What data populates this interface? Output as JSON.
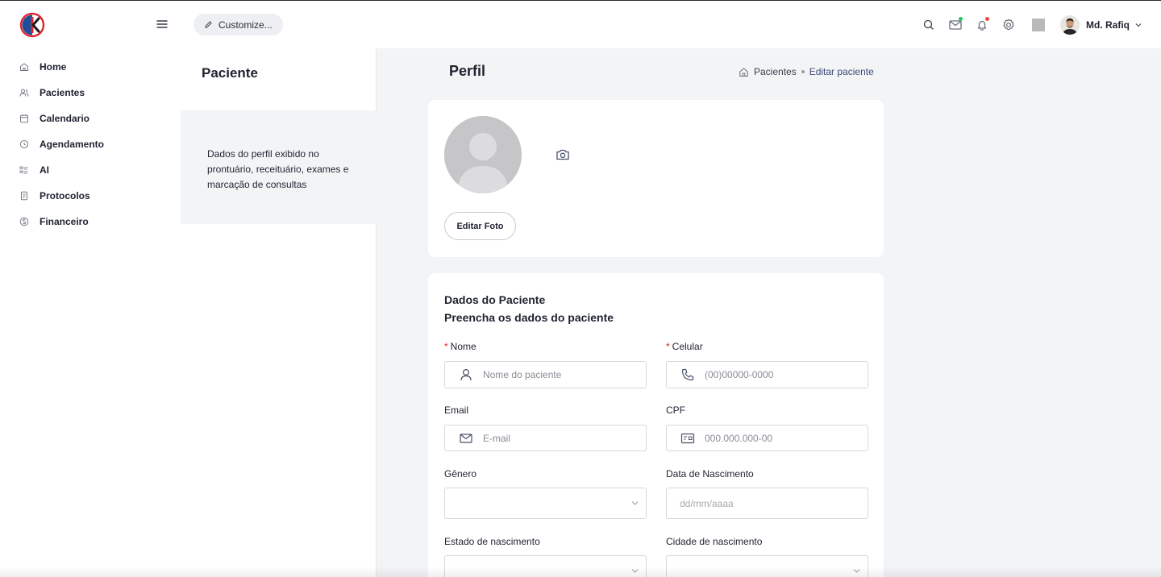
{
  "topbar": {
    "customize_label": "Customize...",
    "user_name": "Md. Rafiq",
    "mail_dot_color": "#22c55e",
    "bell_dot_color": "#ef4444"
  },
  "sidebar": {
    "items": [
      {
        "label": "Home",
        "icon": "home-icon"
      },
      {
        "label": "Pacientes",
        "icon": "users-icon"
      },
      {
        "label": "Calendario",
        "icon": "calendar-icon"
      },
      {
        "label": "Agendamento",
        "icon": "clock-icon"
      },
      {
        "label": "AI",
        "icon": "ai-list-icon"
      },
      {
        "label": "Protocolos",
        "icon": "document-icon"
      },
      {
        "label": "Financeiro",
        "icon": "dollar-icon"
      }
    ]
  },
  "panel": {
    "title": "Paciente",
    "description": "Dados do perfil exibido no prontuário, receituário, exames e marcação de consultas"
  },
  "main": {
    "title": "Perfil",
    "breadcrumb": {
      "link": "Pacientes",
      "current": "Editar paciente"
    }
  },
  "photo_card": {
    "edit_label": "Editar Foto"
  },
  "form": {
    "title": "Dados do Paciente",
    "subtitle": "Preencha os dados do paciente",
    "required_mark": "*",
    "nome": {
      "label": "Nome",
      "placeholder": "Nome do paciente"
    },
    "celular": {
      "label": "Celular",
      "placeholder": "(00)00000-0000"
    },
    "email": {
      "label": "Email",
      "placeholder": "E-mail"
    },
    "cpf": {
      "label": "CPF",
      "placeholder": "000.000.000-00"
    },
    "genero": {
      "label": "Gênero",
      "value": ""
    },
    "nascimento": {
      "label": "Data de Nascimento",
      "placeholder": "dd/mm/aaaa"
    },
    "estado": {
      "label": "Estado de nascimento",
      "value": ""
    },
    "cidade": {
      "label": "Cidade de nascimento",
      "value": ""
    }
  },
  "colors": {
    "accent": "#3d4a7a",
    "required": "#e0262f",
    "logo_red": "#e0262f",
    "logo_blue": "#1f4f9a"
  }
}
